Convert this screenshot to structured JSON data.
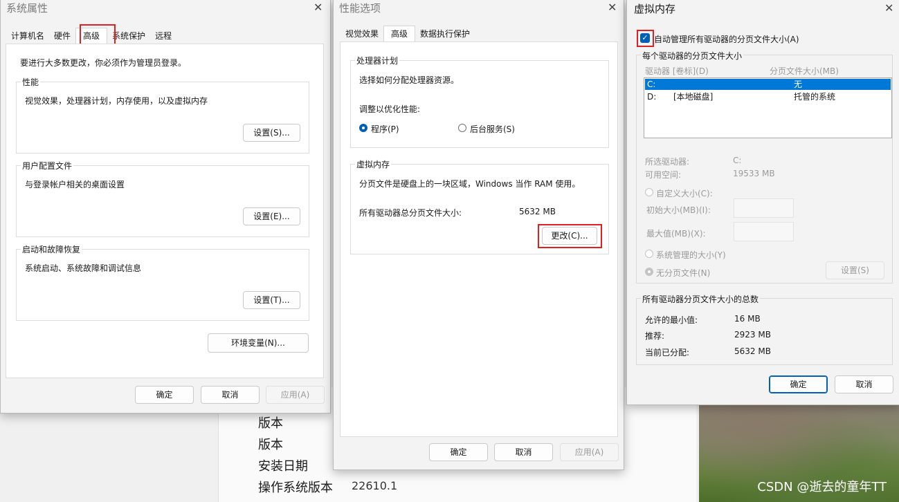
{
  "background": {
    "version_label_1": "版本",
    "version_label_2": "版本",
    "install_date_label": "安装日期",
    "os_build_label": "操作系统版本",
    "os_build_value": "22610.1",
    "watermark": "CSDN @逝去的童年TT"
  },
  "sys_props": {
    "title": "系统属性",
    "tabs": [
      "计算机名",
      "硬件",
      "高级",
      "系统保护",
      "远程"
    ],
    "admin_note": "要进行大多数更改，你必须作为管理员登录。",
    "performance": {
      "title": "性能",
      "desc": "视觉效果，处理器计划，内存使用，以及虚拟内存",
      "button": "设置(S)..."
    },
    "user_profiles": {
      "title": "用户配置文件",
      "desc": "与登录帐户相关的桌面设置",
      "button": "设置(E)..."
    },
    "startup_recovery": {
      "title": "启动和故障恢复",
      "desc": "系统启动、系统故障和调试信息",
      "button": "设置(T)..."
    },
    "env_button": "环境变量(N)...",
    "ok": "确定",
    "cancel": "取消",
    "apply": "应用(A)"
  },
  "perf_options": {
    "title": "性能选项",
    "tabs": [
      "视觉效果",
      "高级",
      "数据执行保护"
    ],
    "processor": {
      "title": "处理器计划",
      "desc": "选择如何分配处理器资源。",
      "adjust_label": "调整以优化性能:",
      "opt_programs": "程序(P)",
      "opt_background": "后台服务(S)"
    },
    "vm": {
      "title": "虚拟内存",
      "desc": "分页文件是硬盘上的一块区域，Windows 当作 RAM 使用。",
      "total_label": "所有驱动器总分页文件大小:",
      "total_value": "5632 MB",
      "change_button": "更改(C)..."
    },
    "ok": "确定",
    "cancel": "取消",
    "apply": "应用(A)"
  },
  "virtual_memory": {
    "title": "虚拟内存",
    "auto_manage_label": "自动管理所有驱动器的分页文件大小(A)",
    "per_drive_title": "每个驱动器的分页文件大小",
    "col_drive": "驱动器 [卷标](D)",
    "col_size": "分页文件大小(MB)",
    "drives": [
      {
        "drive": "C:",
        "label": "",
        "size": "无"
      },
      {
        "drive": "D:",
        "label": "[本地磁盘]",
        "size": "托管的系统"
      }
    ],
    "selected_drive_label": "所选驱动器:",
    "selected_drive_value": "C:",
    "free_space_label": "可用空间:",
    "free_space_value": "19533 MB",
    "custom_size": "自定义大小(C):",
    "initial_size": "初始大小(MB)(I):",
    "max_size": "最大值(MB)(X):",
    "system_managed": "系统管理的大小(Y)",
    "no_paging": "无分页文件(N)",
    "set_button": "设置(S)",
    "totals_title": "所有驱动器分页文件大小的总数",
    "min_allowed_label": "允许的最小值:",
    "min_allowed_value": "16 MB",
    "recommended_label": "推荐:",
    "recommended_value": "2923 MB",
    "allocated_label": "当前已分配:",
    "allocated_value": "5632 MB",
    "ok": "确定",
    "cancel": "取消"
  },
  "colors": {
    "accent": "#005fb8",
    "highlight": "#e02020",
    "selection": "#0078d7"
  }
}
